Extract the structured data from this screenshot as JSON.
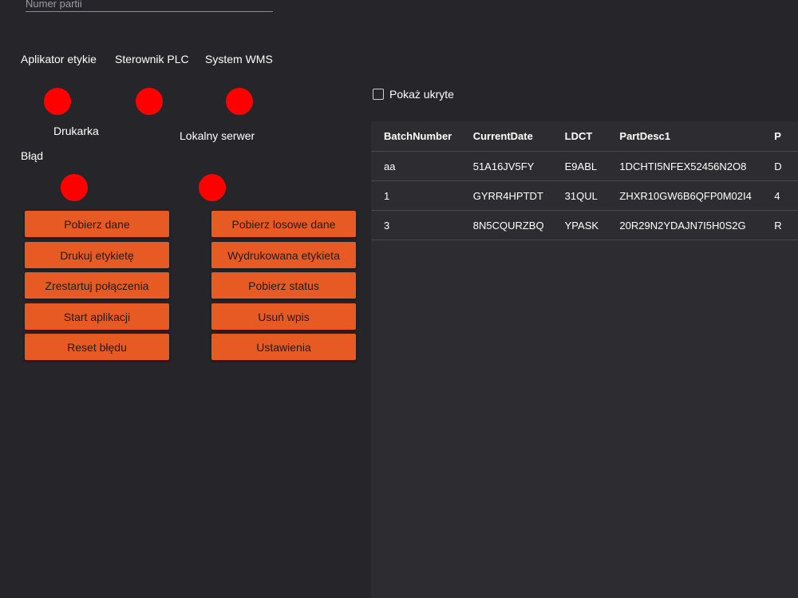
{
  "batch_field": {
    "placeholder": "Numer partii",
    "value": ""
  },
  "status": {
    "row1": [
      {
        "label": "Aplikator etykie",
        "color": "#ff0000"
      },
      {
        "label": "Sterownik PLC",
        "color": "#ff0000"
      },
      {
        "label": "System WMS",
        "color": "#ff0000"
      }
    ],
    "row2": [
      {
        "label": "Drukarka"
      },
      {
        "label": "Lokalny serwer"
      }
    ],
    "row3": [
      {
        "label": "Błąd",
        "color": "#ff0000"
      },
      {
        "color": "#ff0000"
      }
    ]
  },
  "buttons": {
    "left": [
      "Pobierz dane",
      "Drukuj etykietę",
      "Zrestartuj połączenia",
      "Start aplikacji",
      "Reset błędu"
    ],
    "right": [
      "Pobierz losowe dane",
      "Wydrukowana etykieta",
      "Pobierz status",
      "Usuń wpis",
      "Ustawienia"
    ]
  },
  "show_hidden": {
    "label": "Pokaż ukryte",
    "checked": false
  },
  "table": {
    "columns": [
      "BatchNumber",
      "CurrentDate",
      "LDCT",
      "PartDesc1",
      "P"
    ],
    "rows": [
      [
        "aa",
        "51A16JV5FY",
        "E9ABL",
        "1DCHTI5NFEX52456N2O8",
        "D"
      ],
      [
        "1",
        "GYRR4HPTDT",
        "31QUL",
        "ZHXR10GW6B6QFP0M02I4",
        "4"
      ],
      [
        "3",
        "8N5CQURZBQ",
        "YPASK",
        "20R29N2YDAJN7I5H0S2G",
        "R"
      ]
    ]
  },
  "colors": {
    "background": "#26252a",
    "panel": "#2d2c31",
    "accent": "#e85a24",
    "status_error": "#ff0000"
  }
}
